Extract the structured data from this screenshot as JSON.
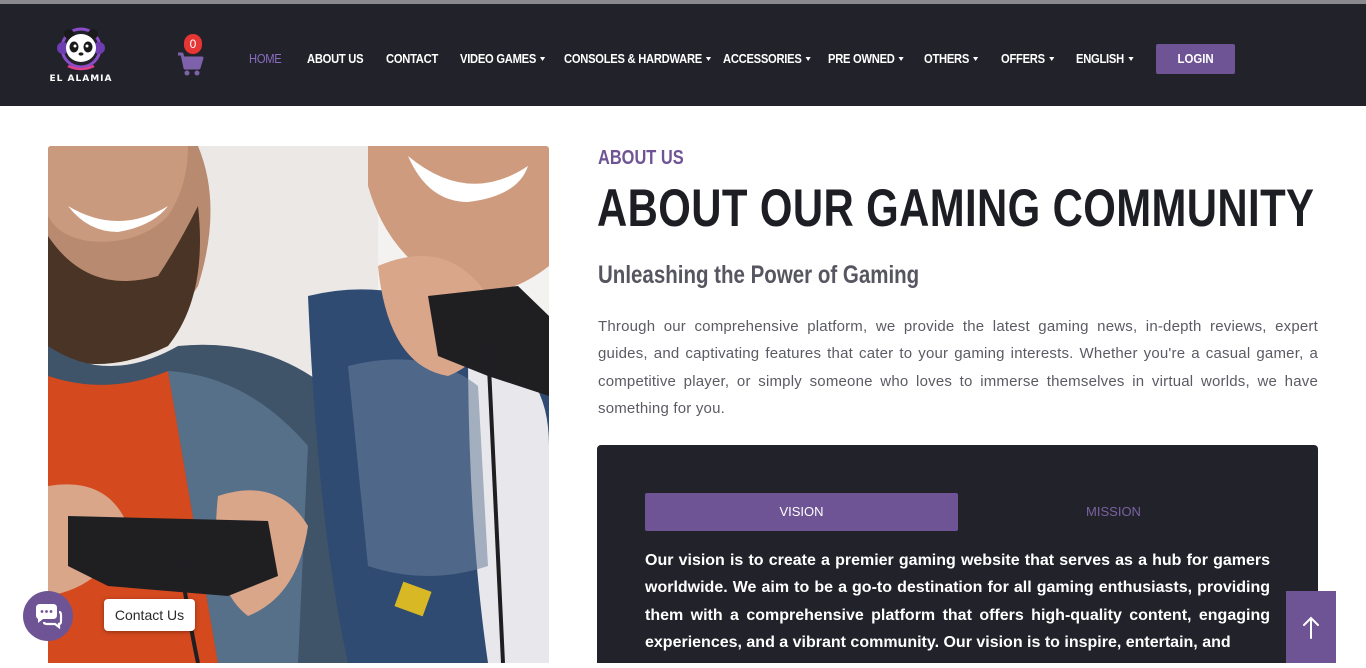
{
  "brand": {
    "name": "EL ALAMIA",
    "logo_icon": "panda-gamer-logo-icon"
  },
  "cart": {
    "count": "0",
    "icon": "cart-icon"
  },
  "nav": {
    "items": [
      {
        "label": "HOME",
        "active": true,
        "dropdown": false
      },
      {
        "label": "ABOUT US",
        "active": false,
        "dropdown": false
      },
      {
        "label": "CONTACT",
        "active": false,
        "dropdown": false
      },
      {
        "label": "VIDEO GAMES",
        "active": false,
        "dropdown": true
      },
      {
        "label": "CONSOLES & HARDWARE",
        "active": false,
        "dropdown": true
      },
      {
        "label": "ACCESSORIES",
        "active": false,
        "dropdown": true
      },
      {
        "label": "PRE OWNED",
        "active": false,
        "dropdown": true
      },
      {
        "label": "OTHERS",
        "active": false,
        "dropdown": true
      },
      {
        "label": "OFFERS",
        "active": false,
        "dropdown": true
      },
      {
        "label": "ENGLISH",
        "active": false,
        "dropdown": true
      }
    ],
    "login_label": "LOGIN"
  },
  "about": {
    "eyebrow": "ABOUT US",
    "headline": "ABOUT OUR GAMING COMMUNITY",
    "subhead": "Unleashing the Power of Gaming",
    "intro": "Through our comprehensive platform, we provide the latest gaming news, in-depth reviews, expert guides, and captivating features that cater to your gaming interests. Whether you're a casual gamer, a competitive player, or simply someone who loves to immerse themselves in virtual worlds, we have something for you."
  },
  "tabs": {
    "vision_label": "VISION",
    "mission_label": "MISSION",
    "active": "VISION",
    "vision_text": "Our vision is to create a premier gaming website that serves as a hub for gamers worldwide. We aim to be a go-to destination for all gaming enthusiasts, providing them with a comprehensive platform that offers high-quality content, engaging experiences, and a vibrant community. Our vision is to inspire, entertain, and"
  },
  "contact_widget": {
    "label": "Contact Us",
    "icon": "chat-bubble-icon"
  },
  "scroll_top": {
    "icon": "arrow-up-icon"
  },
  "colors": {
    "accent": "#6e5494",
    "navbar": "#22222a",
    "heading": "#1d1d24",
    "badge": "#e53535"
  }
}
